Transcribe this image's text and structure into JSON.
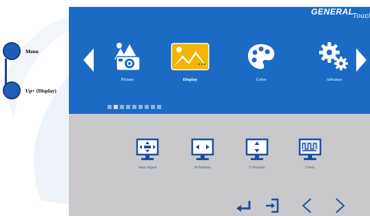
{
  "callouts": [
    {
      "label": "Menu"
    },
    {
      "label": "Up+ (Display)"
    }
  ],
  "brand": {
    "main": "GENERAL",
    "sub": "Touch"
  },
  "tabs": [
    {
      "label": "Picture",
      "icon": "camera-icon",
      "active": false
    },
    {
      "label": "Display",
      "icon": "display-landscape-icon",
      "active": true
    },
    {
      "label": "Color",
      "icon": "palette-icon",
      "active": false
    },
    {
      "label": "Advance",
      "icon": "gears-icon",
      "active": false
    }
  ],
  "pager": {
    "total": 9,
    "active_index": 1
  },
  "display_items": [
    {
      "label": "Auto Adjust",
      "icon": "auto-adjust-icon"
    },
    {
      "label": "H Position",
      "icon": "h-position-icon"
    },
    {
      "label": "V Position",
      "icon": "v-position-icon"
    },
    {
      "label": "Clock",
      "icon": "clock-icon"
    }
  ],
  "controls": [
    "enter-icon",
    "exit-icon",
    "left-icon",
    "right-icon"
  ],
  "colors": {
    "panel_blue": "#1b6bc4",
    "panel_gray": "#c9c9cb",
    "item_blue": "#1a4fa0",
    "active_yellow": "#f4b400"
  }
}
